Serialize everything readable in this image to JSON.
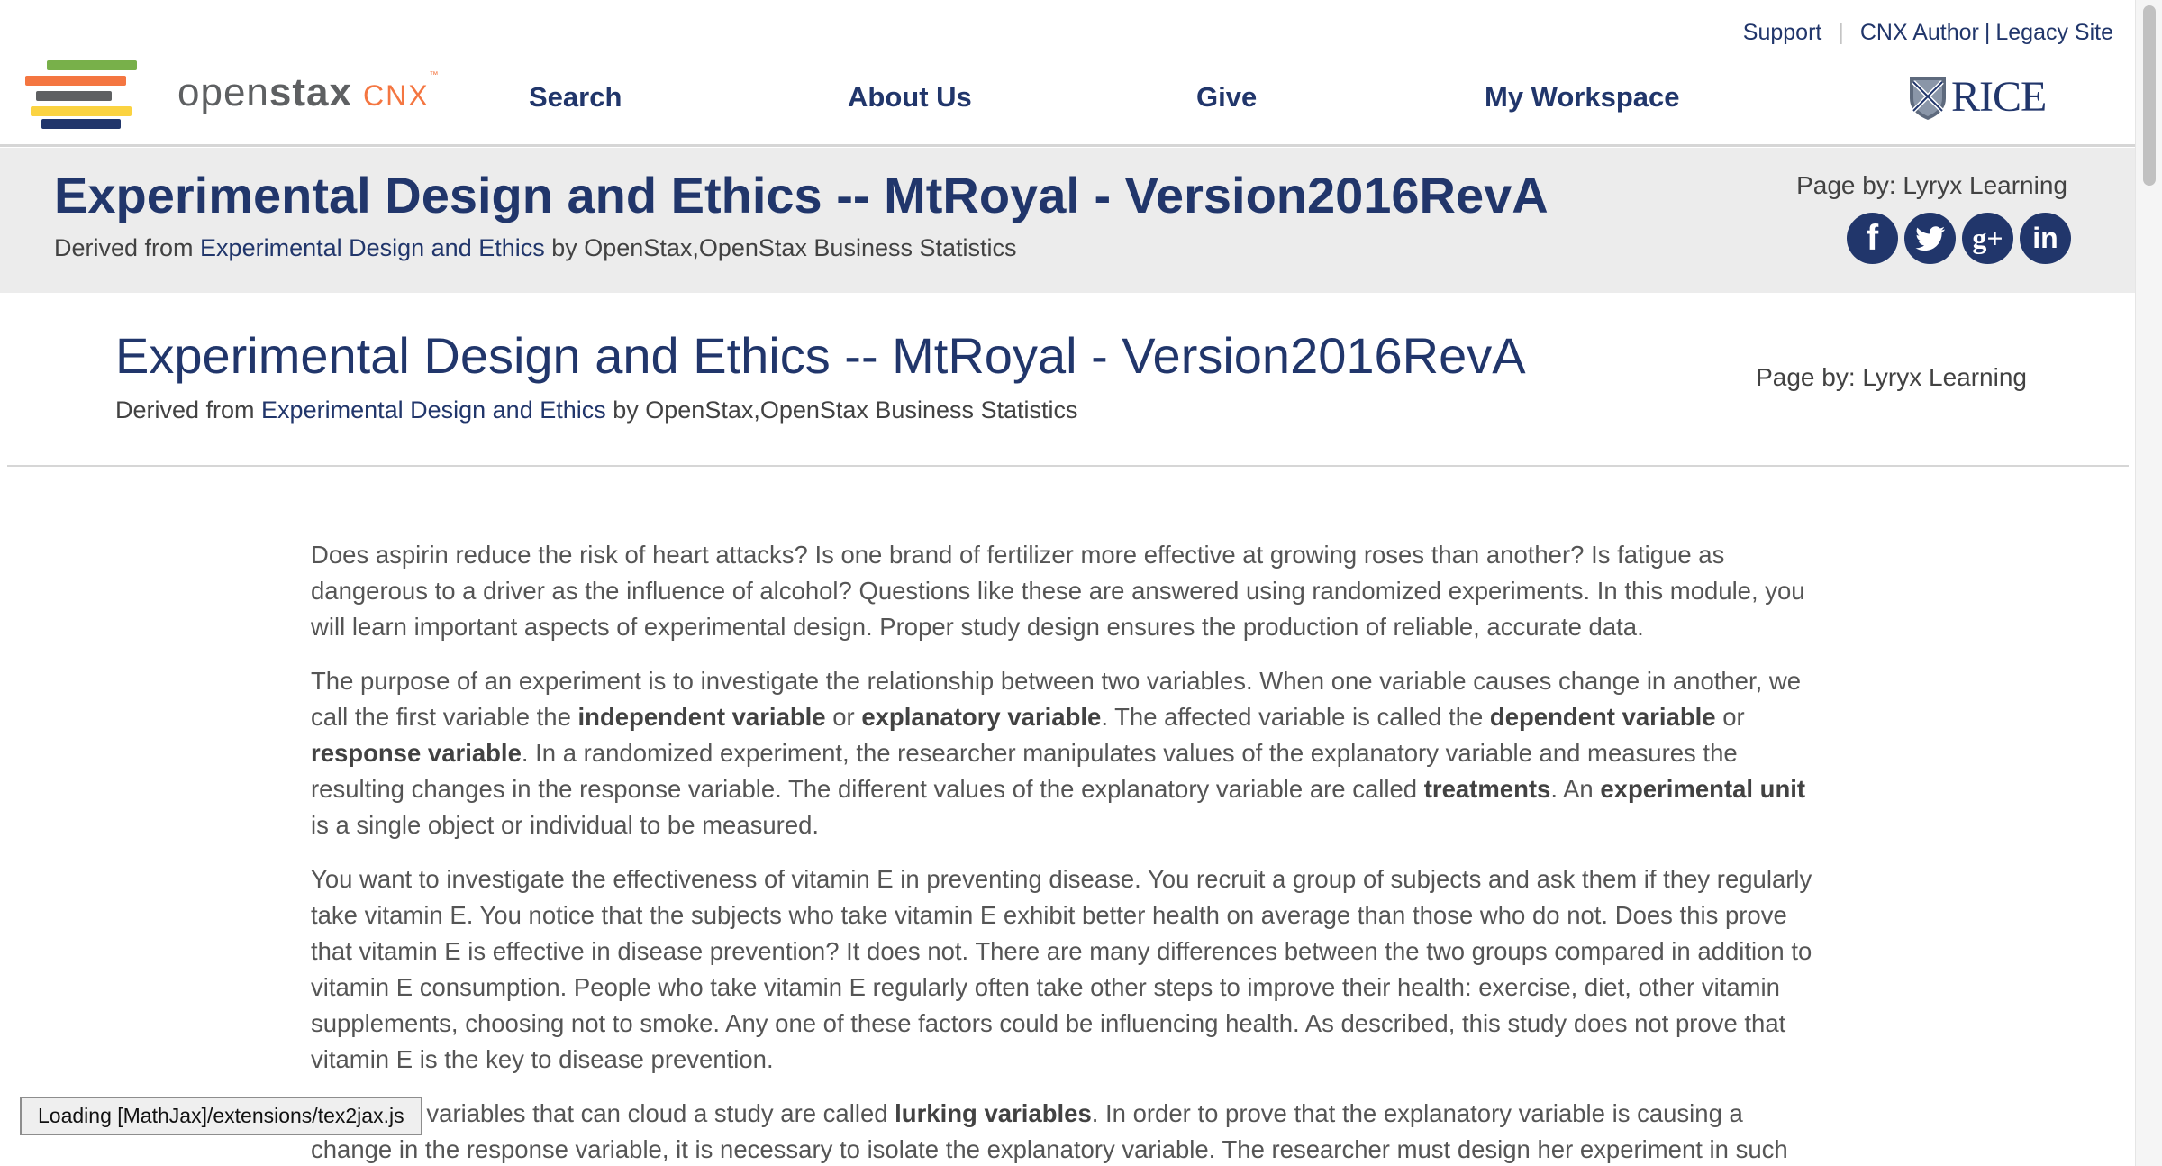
{
  "utility_nav": {
    "support": "Support",
    "author": "CNX Author",
    "legacy": "Legacy Site"
  },
  "logo": {
    "wordmark_light": "open",
    "wordmark_bold": "stax",
    "cnx": "CNX",
    "tm": "™",
    "book_colors": [
      "#78b04a",
      "#f47641",
      "#5e6062",
      "#fbd341",
      "#21366b"
    ]
  },
  "main_nav": {
    "search": "Search",
    "about": "About Us",
    "give": "Give",
    "workspace": "My Workspace"
  },
  "rice_logo": {
    "text": "RICE"
  },
  "title_band": {
    "title": "Experimental Design and Ethics -- MtRoyal - Version2016RevA",
    "derived_prefix": "Derived from ",
    "derived_link": "Experimental Design and Ethics",
    "derived_suffix": " by OpenStax,OpenStax Business Statistics",
    "page_by": "Page by: Lyryx Learning"
  },
  "social": {
    "facebook": "f",
    "twitter": "twitter-icon",
    "googleplus": "g+",
    "linkedin": "in"
  },
  "page_header": {
    "title": "Experimental Design and Ethics -- MtRoyal - Version2016RevA",
    "derived_prefix": "Derived from ",
    "derived_link": "Experimental Design and Ethics",
    "derived_suffix": " by OpenStax,OpenStax Business Statistics",
    "page_by": "Page by: Lyryx Learning"
  },
  "content": {
    "p1": "Does aspirin reduce the risk of heart attacks? Is one brand of fertilizer more effective at growing roses than another? Is fatigue as dangerous to a driver as the influence of alcohol? Questions like these are answered using randomized experiments. In this module, you will learn important aspects of experimental design. Proper study design ensures the production of reliable, accurate data.",
    "p2": {
      "t1": "The purpose of an experiment is to investigate the relationship between two variables. When one variable causes change in another, we call the first variable the ",
      "b1": "independent variable",
      "t2": " or ",
      "b2": "explanatory variable",
      "t3": ". The affected variable is called the ",
      "b3": "dependent variable",
      "t4": " or ",
      "b4": "response variable",
      "t5": ". In a randomized experiment, the researcher manipulates values of the explanatory variable and measures the resulting changes in the response variable. The different values of the explanatory variable are called ",
      "b5": "treatments",
      "t6": ". An ",
      "b6": "experimental unit",
      "t7": " is a single object or individual to be measured."
    },
    "p3": "You want to investigate the effectiveness of vitamin E in preventing disease. You recruit a group of subjects and ask them if they regularly take vitamin E. You notice that the subjects who take vitamin E exhibit better health on average than those who do not. Does this prove that vitamin E is effective in disease prevention? It does not. There are many differences between the two groups compared in addition to vitamin E consumption. People who take vitamin E regularly often take other steps to improve their health: exercise, diet, other vitamin supplements, choosing not to smoke. Any one of these factors could be influencing health. As described, this study does not prove that vitamin E is the key to disease prevention.",
    "p4": {
      "t1": "Additional variables that can cloud a study are called ",
      "b1": "lurking variables",
      "t2": ". In order to prove that the explanatory variable is causing a change in the response variable, it is necessary to isolate the explanatory variable. The researcher must design her experiment in such"
    }
  },
  "status": {
    "loading": "Loading [MathJax]/extensions/tex2jax.js"
  }
}
